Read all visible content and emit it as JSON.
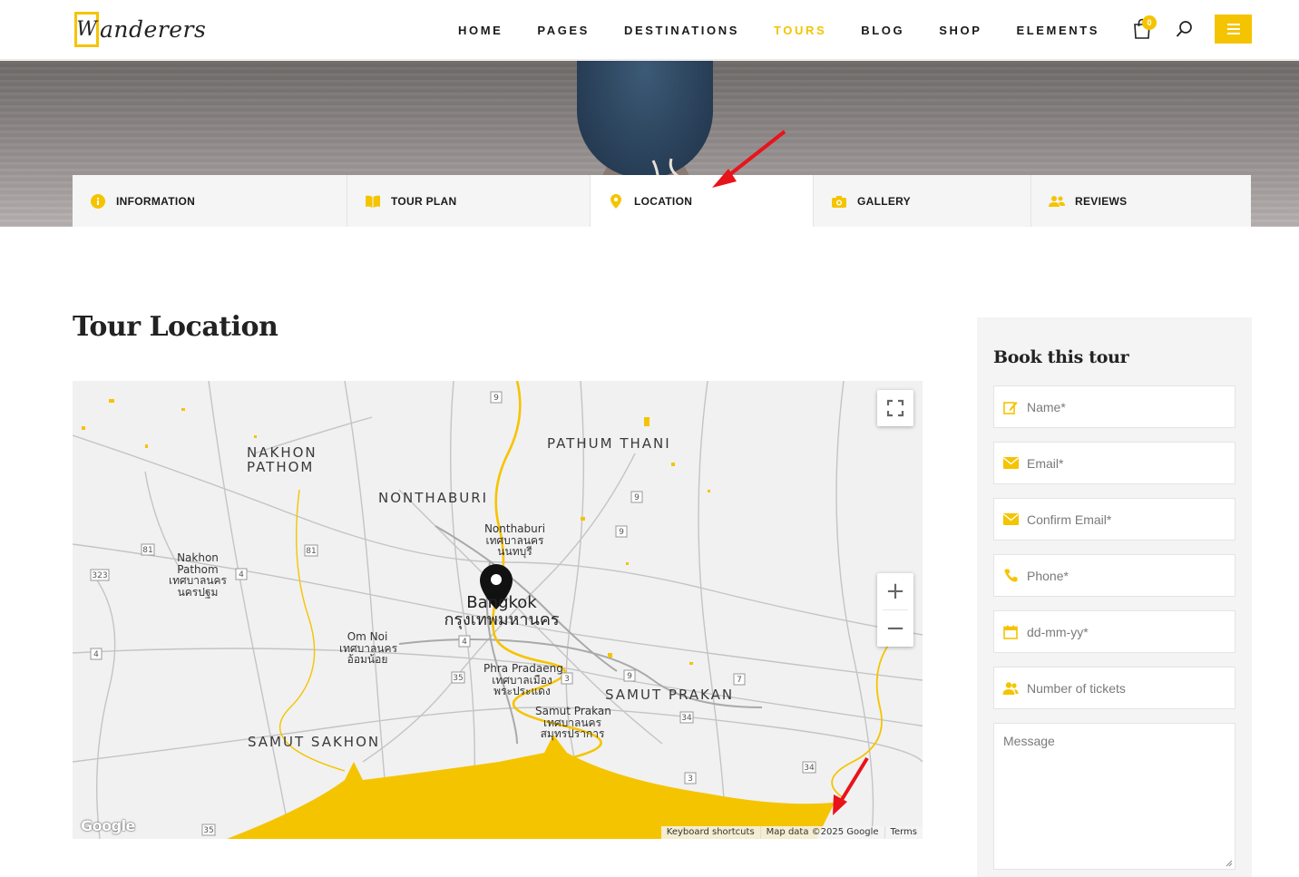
{
  "header": {
    "logo_mark": "W",
    "logo_text": "anderers",
    "nav": [
      {
        "label": "HOME",
        "active": false
      },
      {
        "label": "PAGES",
        "active": false
      },
      {
        "label": "DESTINATIONS",
        "active": false
      },
      {
        "label": "TOURS",
        "active": true
      },
      {
        "label": "BLOG",
        "active": false
      },
      {
        "label": "SHOP",
        "active": false
      },
      {
        "label": "ELEMENTS",
        "active": false
      }
    ],
    "cart_count": "0",
    "icons": {
      "cart": "shopping-bag-icon",
      "search": "search-icon",
      "menu": "hamburger-menu-icon"
    }
  },
  "tabs": [
    {
      "label": "INFORMATION",
      "icon": "info-icon"
    },
    {
      "label": "TOUR PLAN",
      "icon": "book-icon"
    },
    {
      "label": "LOCATION",
      "icon": "map-pin-icon",
      "active": true
    },
    {
      "label": "GALLERY",
      "icon": "camera-icon"
    },
    {
      "label": "REVIEWS",
      "icon": "users-icon"
    }
  ],
  "section_title": "Tour Location",
  "map": {
    "regions": {
      "nakhon_pathom_1": "NAKHON",
      "nakhon_pathom_2": "PATHOM",
      "pathum_thani": "PATHUM THANI",
      "nonthaburi": "NONTHABURI",
      "samut_prakan": "SAMUT PRAKAN",
      "samut_sakhon": "SAMUT SAKHON"
    },
    "cities": {
      "nonthaburi_1": "Nonthaburi",
      "nonthaburi_2": "เทศบาลนคร",
      "nonthaburi_3": "นนทบุรี",
      "nakhon_pathom_1": "Nakhon",
      "nakhon_pathom_2": "Pathom",
      "nakhon_pathom_3": "เทศบาลนคร",
      "nakhon_pathom_4": "นครปฐม",
      "om_noi_1": "Om Noi",
      "om_noi_2": "เทศบาลนคร",
      "om_noi_3": "อ้อมน้อย",
      "phra_pradaeng_1": "Phra Pradaeng",
      "phra_pradaeng_2": "เทศบาลเมือง",
      "phra_pradaeng_3": "พระประแดง",
      "samut_prakan_1": "Samut Prakan",
      "samut_prakan_2": "เทศบาลนคร",
      "samut_prakan_3": "สมุทรปราการ",
      "bangkok_1": "Bangkok",
      "bangkok_2": "กรุงเทพมหานคร"
    },
    "shields": [
      "9",
      "9",
      "9",
      "9",
      "81",
      "81",
      "323",
      "4",
      "4",
      "4",
      "35",
      "3",
      "9",
      "7",
      "34",
      "3",
      "34",
      "35"
    ],
    "google_logo": "Google",
    "attribution": {
      "shortcuts": "Keyboard shortcuts",
      "data": "Map data ©2025 Google",
      "terms": "Terms"
    },
    "controls": {
      "fullscreen": "fullscreen-icon",
      "zoom_in": "+",
      "zoom_out": "−"
    },
    "colors": {
      "water": "#f5c400",
      "land": "#f1f1f1",
      "roads": "#bdbdbd"
    }
  },
  "booking": {
    "title": "Book this tour",
    "fields": [
      {
        "placeholder": "Name*",
        "icon": "edit-icon"
      },
      {
        "placeholder": "Email*",
        "icon": "envelope-icon"
      },
      {
        "placeholder": "Confirm Email*",
        "icon": "envelope-icon"
      },
      {
        "placeholder": "Phone*",
        "icon": "phone-icon"
      },
      {
        "placeholder": "dd-mm-yy*",
        "icon": "calendar-icon"
      },
      {
        "placeholder": "Number of tickets",
        "icon": "users-icon"
      }
    ],
    "message_placeholder": "Message"
  },
  "colors": {
    "accent": "#f5c400",
    "text": "#1a1a1a",
    "annotation": "#e8141b"
  }
}
